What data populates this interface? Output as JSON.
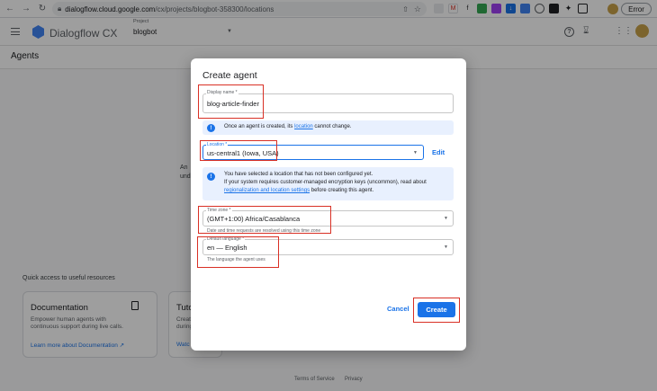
{
  "browser": {
    "url_host": "dialogflow.cloud.google.com",
    "url_path": "/cx/projects/blogbot-358300/locations",
    "error_label": "Error"
  },
  "app": {
    "title": "Dialogflow CX",
    "project_caption": "Project",
    "project_value": "blogbot"
  },
  "page": {
    "title": "Agents",
    "frag_1": "An",
    "frag_2": "und",
    "quick_access_title": "Quick access to useful resources",
    "cards": [
      {
        "title": "Documentation",
        "description": "Empower human agents with continuous support during live calls.",
        "link": "Learn more about Documentation"
      },
      {
        "title": "Tuto",
        "description": "Creat during",
        "link": "Watc"
      }
    ],
    "footer": {
      "terms": "Terms of Service",
      "privacy": "Privacy"
    }
  },
  "dialog": {
    "title": "Create agent",
    "display_name": {
      "label": "Display name *",
      "value": "blog-article-finder"
    },
    "location_info": {
      "text_before": "Once an agent is created, its",
      "link": "location",
      "text_after": "cannot change."
    },
    "location": {
      "label": "Location *",
      "value": "us-central1 (Iowa, USA)",
      "edit_label": "Edit"
    },
    "encryption_info": {
      "line1": "You have selected a location that has not been configured yet.",
      "line2": "If your system requires customer-managed encryption keys (uncommon), read about",
      "link": "regionalization and location settings",
      "line3_after": "before creating this agent."
    },
    "time_zone": {
      "label": "Time zone *",
      "value": "(GMT+1:00) Africa/Casablanca",
      "hint": "Date and time requests are resolved using this time zone"
    },
    "language": {
      "label": "Default language *",
      "value": "en — English",
      "hint": "The language the agent uses"
    },
    "cancel_label": "Cancel",
    "create_label": "Create"
  },
  "colors": {
    "primary": "#1a73e8",
    "annotation_red": "#d93025",
    "info_bg": "#e8f0fe"
  }
}
